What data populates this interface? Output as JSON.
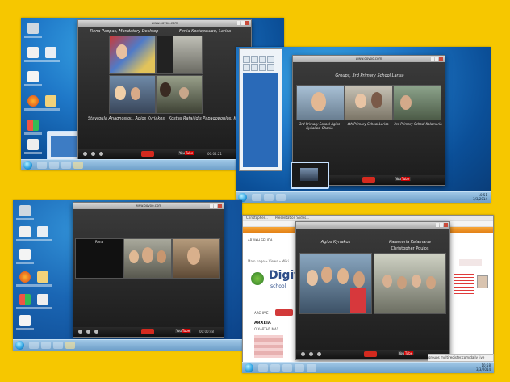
{
  "screens": {
    "top_left": {
      "window_title": "www.oovoo.com",
      "participants": [
        "Rena Pappas, Mandatory Desktop",
        "Fenia Kostopoulou, Larisa",
        "Stavroula Anagnostou, Agios Kyriakos",
        "Kostas Rafailidis Papadopoulos, Kalamaria"
      ],
      "youtube_label": "You",
      "youtube_suffix": "Tube",
      "call_time": "00:04:21"
    },
    "top_right": {
      "window_title": "www.oovoo.com",
      "session_title": "Groups, 3rd Primary School Larisa",
      "participants": [
        "3rd Primary School Agios Kyriakos, Chania",
        "4th Primary School Larisa",
        "3rd Primary School Kalamaria"
      ],
      "youtube_label": "You",
      "youtube_suffix": "Tube",
      "tray_time": "10:51",
      "tray_date": "3/3/2014"
    },
    "bottom_left": {
      "window_title": "www.oovoo.com",
      "empty_tile_label": "Rena",
      "youtube_label": "You",
      "youtube_suffix": "Tube",
      "call_time": "00:00:48"
    },
    "bottom_right": {
      "browser_tab": "Christopher...",
      "browser_tab2": "Presentation Slides...",
      "site_menu": "ARXIKH SELIDA",
      "page_heading": "Digital",
      "page_subheading": "school",
      "breadcrumb": "Main page » Views » Wiki",
      "side_link": "ARCHIVE",
      "section_title": "ARXEIA",
      "section_caption": "Ο ΧΑΡΤΗΣ ΜΑΣ",
      "participants": [
        "Agios Kyriakos",
        "Kalamaria Kalamaria",
        "Christopher Poulos"
      ],
      "youtube_label": "You",
      "youtube_suffix": "Tube",
      "status_text": "groups multiregister.com/daily live",
      "tray_time": "10:58",
      "tray_date": "3/3/2014"
    }
  },
  "colors": {
    "page_bg": "#f6c700",
    "desktop": "#1f78c8",
    "end_call": "#d42a1f"
  }
}
